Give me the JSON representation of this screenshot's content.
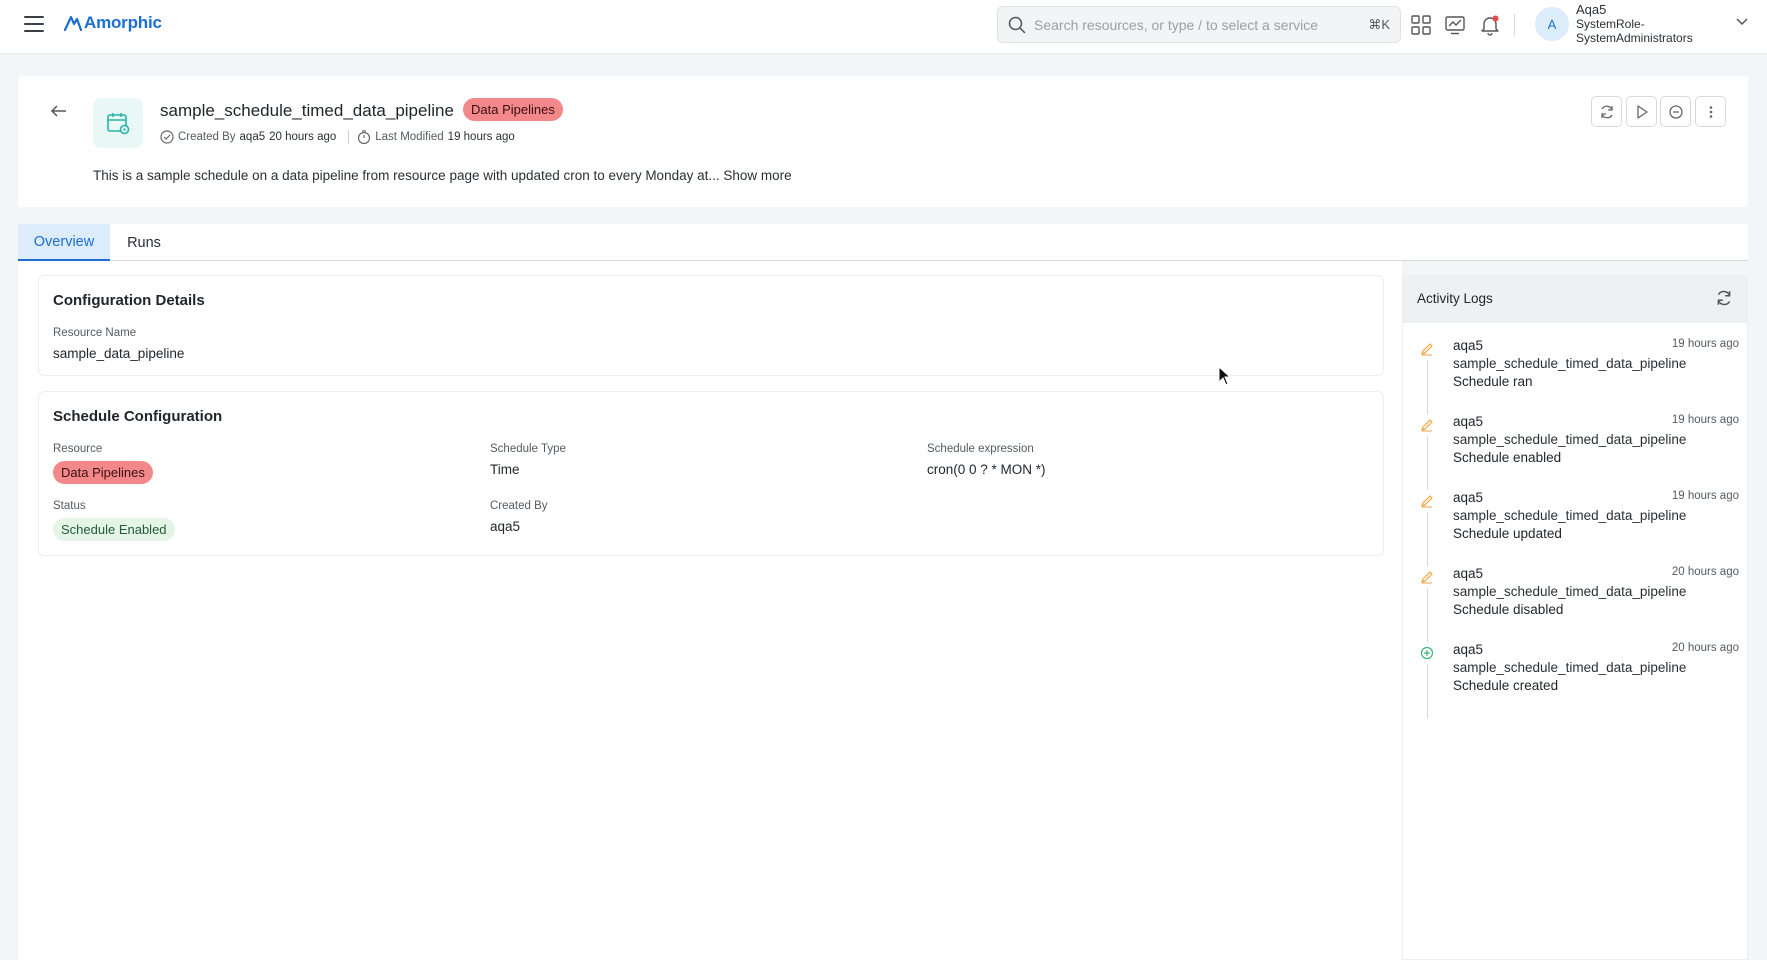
{
  "app": {
    "name": "Amorphic"
  },
  "topbar": {
    "search_placeholder": "Search resources, or type / to select a service",
    "shortcut": "⌘K",
    "icons": [
      "apps-grid-icon",
      "analytics-icon",
      "notification-bell-icon"
    ],
    "user": {
      "initial": "A",
      "name": "Aqa5",
      "role_line1": "SystemRole-",
      "role_line2": "SystemAdministrators"
    }
  },
  "header": {
    "title": "sample_schedule_timed_data_pipeline",
    "type_badge": "Data Pipelines",
    "created_label": "Created By",
    "created_by": "aqa5",
    "created_ago": "20 hours ago",
    "modified_label": "Last Modified",
    "modified_ago": "19 hours ago",
    "description": "This is a sample schedule on a data pipeline from resource page with updated cron to every Monday at...",
    "show_more": "Show more"
  },
  "tabs": [
    {
      "label": "Overview",
      "active": true
    },
    {
      "label": "Runs",
      "active": false
    }
  ],
  "configuration_details": {
    "title": "Configuration Details",
    "resource_name_label": "Resource Name",
    "resource_name": "sample_data_pipeline"
  },
  "schedule_configuration": {
    "title": "Schedule Configuration",
    "resource_label": "Resource",
    "resource": "Data Pipelines",
    "type_label": "Schedule Type",
    "type": "Time",
    "expression_label": "Schedule expression",
    "expression": "cron(0 0 ? * MON *)",
    "status_label": "Status",
    "status": "Schedule Enabled",
    "created_by_label": "Created By",
    "created_by": "aqa5"
  },
  "activity_logs": {
    "title": "Activity Logs",
    "items": [
      {
        "user": "aqa5",
        "time": "19 hours ago",
        "resource": "sample_schedule_timed_data_pipeline",
        "action": "Schedule ran",
        "icon": "edit-icon"
      },
      {
        "user": "aqa5",
        "time": "19 hours ago",
        "resource": "sample_schedule_timed_data_pipeline",
        "action": "Schedule enabled",
        "icon": "edit-icon"
      },
      {
        "user": "aqa5",
        "time": "19 hours ago",
        "resource": "sample_schedule_timed_data_pipeline",
        "action": "Schedule updated",
        "icon": "edit-icon"
      },
      {
        "user": "aqa5",
        "time": "20 hours ago",
        "resource": "sample_schedule_timed_data_pipeline",
        "action": "Schedule disabled",
        "icon": "edit-icon"
      },
      {
        "user": "aqa5",
        "time": "20 hours ago",
        "resource": "sample_schedule_timed_data_pipeline",
        "action": "Schedule created",
        "icon": "add-circle-icon"
      }
    ]
  },
  "colors": {
    "brand": "#1b6fd0",
    "badge_red": "#f2888a",
    "badge_green": "#e4f5e8",
    "edit_icon": "#f0a33c",
    "create_icon": "#3cb371"
  }
}
